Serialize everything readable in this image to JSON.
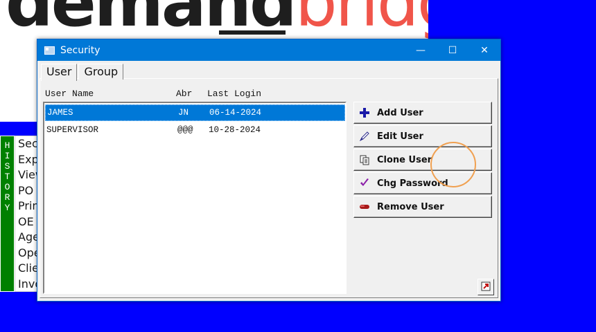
{
  "background": {
    "logo": {
      "dark_part": "demand",
      "red_part": "bridge"
    },
    "history_bar": {
      "letters": [
        "H",
        "I",
        "S",
        "T",
        "O",
        "R",
        "Y"
      ]
    },
    "menu_items": [
      "Sec",
      "Exp",
      "View",
      "PO",
      "Prin",
      "OE",
      "Age",
      "Ope",
      "Clie",
      "Invo"
    ]
  },
  "window": {
    "title": "Security",
    "controls": {
      "minimize": "—",
      "maximize": "☐",
      "close": "✕"
    },
    "tabs": [
      {
        "label": "User",
        "active": true
      },
      {
        "label": "Group",
        "active": false
      }
    ],
    "columns": {
      "user_name": "User Name",
      "abr": "Abr",
      "last_login": "Last Login"
    },
    "rows": [
      {
        "user_name": "JAMES",
        "abr": "JN",
        "last_login": "06-14-2024",
        "selected": true
      },
      {
        "user_name": "SUPERVISOR",
        "abr": "@@@",
        "last_login": "10-28-2024",
        "selected": false
      }
    ],
    "buttons": {
      "add_user": {
        "label": "Add User",
        "icon": "plus-icon"
      },
      "edit_user": {
        "label": "Edit User",
        "icon": "pen-icon"
      },
      "clone_user": {
        "label": "Clone User",
        "icon": "copy-icon"
      },
      "chg_password": {
        "label": "Chg Password",
        "icon": "checkmark-icon"
      },
      "remove_user": {
        "label": "Remove User",
        "icon": "eraser-icon"
      }
    }
  },
  "colors": {
    "desktop": "#0000ff",
    "titlebar": "#0078d7",
    "selection": "#0078d7",
    "history": "#008000",
    "logo_red": "#f0554a",
    "cursor_highlight": "#f0a050"
  }
}
